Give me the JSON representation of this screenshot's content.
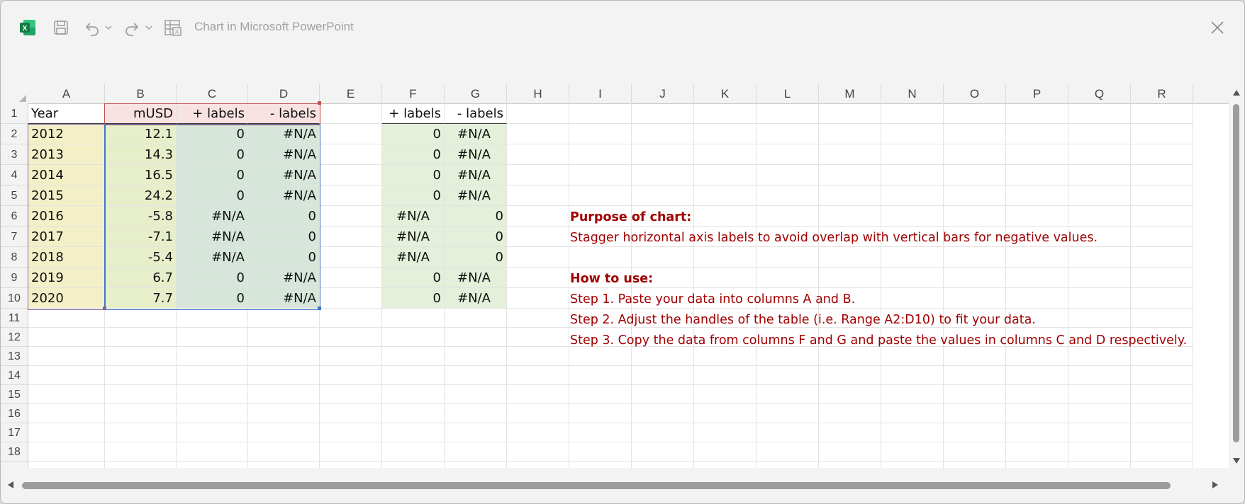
{
  "window": {
    "title": "Chart in Microsoft PowerPoint",
    "icons": [
      "excel-icon",
      "save-icon",
      "undo-icon",
      "redo-icon",
      "edit-data-in-excel-icon",
      "close-icon"
    ]
  },
  "columns": [
    "A",
    "B",
    "C",
    "D",
    "E",
    "F",
    "G",
    "H",
    "I",
    "J",
    "K",
    "L",
    "M",
    "N",
    "O",
    "P",
    "Q",
    "R"
  ],
  "rows": [
    "1",
    "2",
    "3",
    "4",
    "5",
    "6",
    "7",
    "8",
    "9",
    "10",
    "11",
    "12",
    "13",
    "14",
    "15",
    "16",
    "17",
    "18"
  ],
  "table1": {
    "headers": [
      "Year",
      "mUSD",
      "+ labels",
      "- labels"
    ],
    "rows": [
      [
        "2012",
        "12.1",
        "0",
        "#N/A"
      ],
      [
        "2013",
        "14.3",
        "0",
        "#N/A"
      ],
      [
        "2014",
        "16.5",
        "0",
        "#N/A"
      ],
      [
        "2015",
        "24.2",
        "0",
        "#N/A"
      ],
      [
        "2016",
        "-5.8",
        "#N/A",
        "0"
      ],
      [
        "2017",
        "-7.1",
        "#N/A",
        "0"
      ],
      [
        "2018",
        "-5.4",
        "#N/A",
        "0"
      ],
      [
        "2019",
        "6.7",
        "0",
        "#N/A"
      ],
      [
        "2020",
        "7.7",
        "0",
        "#N/A"
      ]
    ]
  },
  "table2": {
    "headers": [
      "+ labels",
      "- labels"
    ],
    "rows": [
      [
        "0",
        "#N/A"
      ],
      [
        "0",
        "#N/A"
      ],
      [
        "0",
        "#N/A"
      ],
      [
        "0",
        "#N/A"
      ],
      [
        "#N/A",
        "0"
      ],
      [
        "#N/A",
        "0"
      ],
      [
        "#N/A",
        "0"
      ],
      [
        "0",
        "#N/A"
      ],
      [
        "0",
        "#N/A"
      ]
    ]
  },
  "notes": {
    "purpose_title": "Purpose of chart:",
    "purpose_text": "Stagger horizontal axis labels to avoid overlap with vertical bars for negative values.",
    "howto_title": "How to use:",
    "step1": "Step 1. Paste your data into columns A and B.",
    "step2": "Step 2. Adjust the handles of the table (i.e. Range A2:D10) to fit your data.",
    "step3": "Step 3. Copy the data from columns F and G and paste the values in columns C and D respectively."
  },
  "colors": {
    "note_text": "#a00000",
    "year_fill": "#f3f0c8",
    "value_fill": "#e7efca",
    "label_fill": "#d6e6da",
    "header_fill": "#f8e2e2",
    "helper_fill": "#e4f0d9"
  }
}
